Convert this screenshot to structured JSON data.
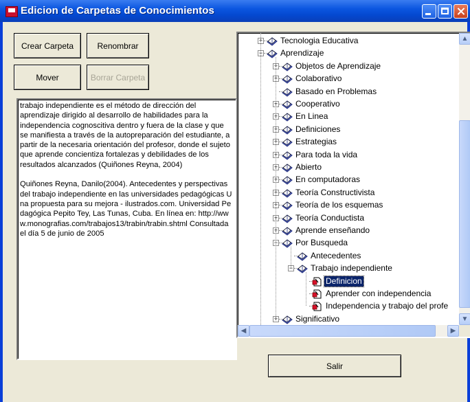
{
  "window": {
    "title": "Edicion de Carpetas de Conocimientos"
  },
  "buttons": {
    "create": "Crear Carpeta",
    "rename": "Renombrar",
    "move": "Mover",
    "delete": "Borrar Carpeta",
    "exit": "Salir"
  },
  "memo": {
    "paragraph1": "trabajo independiente es el método de dirección del aprendizaje dirigido al desarrollo de habilidades para la independencia cognoscitiva dentro y fuera de la clase y que se manifiesta a través de la autopreparación del estudiante, a partir de la necesaria orientación del profesor, donde el sujeto que aprende concientiza fortalezas y debilidades de los resultados alcanzados (Quiñones Reyna, 2004)",
    "paragraph2": "Quiñones Reyna, Danilo(2004). Antecedentes y perspectivas del trabajo independiente en las universidades pedagógicas Una propuesta para su mejora - ilustrados.com. Universidad Pedagógica Pepito Tey, Las Tunas, Cuba. En línea en: http://www.monografias.com/trabajos13/trabin/trabin.shtml Consultada el  día 5 de junio de 2005"
  },
  "tree": {
    "nodes": [
      {
        "label": "Tecnologia Educativa",
        "level": 0,
        "expander": "+",
        "icon": "book-icon"
      },
      {
        "label": "Aprendizaje",
        "level": 0,
        "expander": "-",
        "icon": "book-icon"
      },
      {
        "label": "Objetos de Aprendizaje",
        "level": 1,
        "expander": "+",
        "icon": "book-icon"
      },
      {
        "label": "Colaborativo",
        "level": 1,
        "expander": "+",
        "icon": "book-icon"
      },
      {
        "label": "Basado en Problemas",
        "level": 1,
        "expander": "",
        "icon": "book-icon"
      },
      {
        "label": "Cooperativo",
        "level": 1,
        "expander": "+",
        "icon": "book-icon"
      },
      {
        "label": "En Linea",
        "level": 1,
        "expander": "+",
        "icon": "book-icon"
      },
      {
        "label": "Definiciones",
        "level": 1,
        "expander": "+",
        "icon": "book-icon"
      },
      {
        "label": "Estrategias",
        "level": 1,
        "expander": "+",
        "icon": "book-icon"
      },
      {
        "label": "Para toda la vida",
        "level": 1,
        "expander": "+",
        "icon": "book-icon"
      },
      {
        "label": "Abierto",
        "level": 1,
        "expander": "+",
        "icon": "book-icon"
      },
      {
        "label": "En computadoras",
        "level": 1,
        "expander": "+",
        "icon": "book-icon"
      },
      {
        "label": "Teoría Constructivista",
        "level": 1,
        "expander": "+",
        "icon": "book-icon"
      },
      {
        "label": "Teoría de los esquemas",
        "level": 1,
        "expander": "+",
        "icon": "book-icon"
      },
      {
        "label": "Teoría Conductista",
        "level": 1,
        "expander": "+",
        "icon": "book-icon"
      },
      {
        "label": "Aprende enseñando",
        "level": 1,
        "expander": "+",
        "icon": "book-icon"
      },
      {
        "label": "Por Busqueda",
        "level": 1,
        "expander": "-",
        "icon": "book-icon"
      },
      {
        "label": "Antecedentes",
        "level": 2,
        "expander": "",
        "icon": "book-icon"
      },
      {
        "label": "Trabajo independiente",
        "level": 2,
        "expander": "-",
        "icon": "book-icon"
      },
      {
        "label": "Definicion",
        "level": 3,
        "expander": "",
        "icon": "document-icon",
        "selected": true
      },
      {
        "label": "Aprender con independencia",
        "level": 3,
        "expander": "",
        "icon": "document-icon"
      },
      {
        "label": "Independencia y trabajo del profe",
        "level": 3,
        "expander": "",
        "icon": "document-icon"
      },
      {
        "label": "Significativo",
        "level": 1,
        "expander": "+",
        "icon": "book-icon"
      }
    ]
  },
  "colors": {
    "title_bar": "#0B56E0",
    "selection": "#0A246A",
    "face": "#ECE9D8"
  }
}
